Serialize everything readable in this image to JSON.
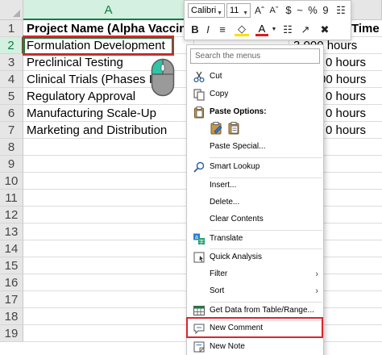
{
  "spreadsheet": {
    "columns": [
      {
        "letter": "A",
        "active": true
      },
      {
        "letter": "",
        "active": false
      },
      {
        "letter": "",
        "active": false
      }
    ],
    "row_numbers": [
      "1",
      "2",
      "3",
      "4",
      "5",
      "6",
      "7",
      "8",
      "9",
      "10",
      "11",
      "12",
      "13",
      "14",
      "15",
      "16",
      "17",
      "18",
      "19"
    ],
    "header_row": {
      "a": "Project Name (Alpha Vaccines",
      "b": "",
      "c": "Time"
    },
    "rows": [
      {
        "a": "Formulation Development",
        "b": "",
        "c": "3,000 hours"
      },
      {
        "a": "Preclinical Testing",
        "b": "",
        "c": "0 hours"
      },
      {
        "a": "Clinical Trials (Phases I-II",
        "b": "",
        "c": "00 hours"
      },
      {
        "a": "Regulatory Approval",
        "b": "",
        "c": "0 hours"
      },
      {
        "a": "Manufacturing Scale-Up",
        "b": "",
        "c": "0 hours"
      },
      {
        "a": "Marketing and Distribution",
        "b": "",
        "c": "0 hours"
      }
    ],
    "selected_cell": "A2"
  },
  "mini_toolbar": {
    "font_name": "Calibri",
    "font_size": "11",
    "buttons_row1": [
      "Aˆ",
      "Aˇ",
      "$",
      "~",
      "%",
      "9",
      "☷"
    ],
    "buttons_row2": [
      "B",
      "I",
      "≡",
      "A",
      "↓",
      "☷",
      "↗",
      "✖"
    ]
  },
  "context_menu": {
    "search_placeholder": "Search the menus",
    "items": [
      {
        "label": "Cut",
        "icon": "scissors-icon"
      },
      {
        "label": "Copy",
        "icon": "copy-icon"
      },
      {
        "label": "Paste Options:",
        "icon": "clipboard-icon",
        "bold": true
      },
      {
        "label": "Paste Special...",
        "icon": ""
      },
      {
        "label": "Smart Lookup",
        "icon": "search-icon"
      },
      {
        "label": "Insert...",
        "icon": ""
      },
      {
        "label": "Delete...",
        "icon": ""
      },
      {
        "label": "Clear Contents",
        "icon": ""
      },
      {
        "label": "Translate",
        "icon": "translate-icon"
      },
      {
        "label": "Quick Analysis",
        "icon": "quick-analysis-icon"
      },
      {
        "label": "Filter",
        "icon": "",
        "submenu": true
      },
      {
        "label": "Sort",
        "icon": "",
        "submenu": true
      },
      {
        "label": "Get Data from Table/Range...",
        "icon": "table-icon"
      },
      {
        "label": "New Comment",
        "icon": "comment-icon",
        "highlighted": true
      },
      {
        "label": "New Note",
        "icon": "note-icon"
      }
    ],
    "submenu_arrow": "›"
  },
  "colors": {
    "excel_green": "#107c41",
    "highlight_red": "#d9262c",
    "mouse_teal": "#2ec4a6"
  }
}
